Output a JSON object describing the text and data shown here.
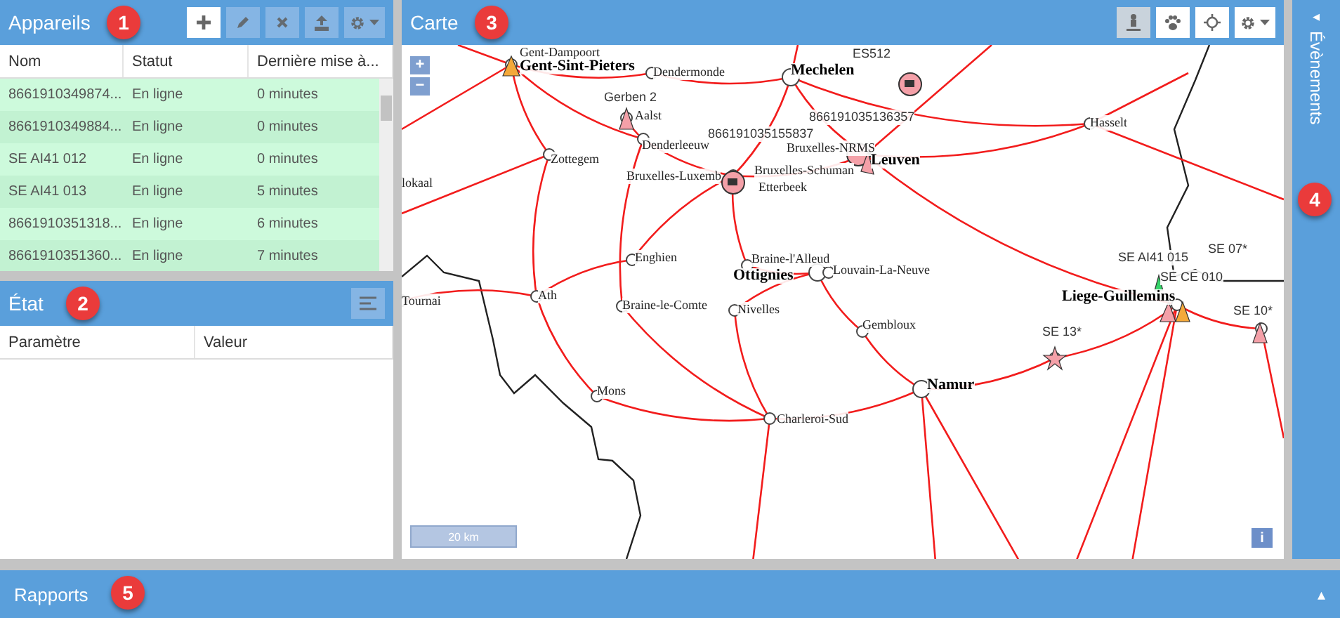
{
  "devices_panel": {
    "title": "Appareils",
    "toolbar": [
      {
        "kind": "add",
        "disabled": false
      },
      {
        "kind": "edit",
        "disabled": true
      },
      {
        "kind": "delete",
        "disabled": true
      },
      {
        "kind": "upload",
        "disabled": true
      },
      {
        "kind": "settings",
        "disabled": true
      }
    ],
    "columns": [
      "Nom",
      "Statut",
      "Dernière mise à..."
    ],
    "rows": [
      {
        "name": "8661910349874...",
        "status": "En ligne",
        "updated": "0 minutes"
      },
      {
        "name": "8661910349884...",
        "status": "En ligne",
        "updated": "0 minutes"
      },
      {
        "name": "SE AI41 012",
        "status": "En ligne",
        "updated": "0 minutes"
      },
      {
        "name": "SE AI41 013",
        "status": "En ligne",
        "updated": "5 minutes"
      },
      {
        "name": "8661910351318...",
        "status": "En ligne",
        "updated": "6 minutes"
      },
      {
        "name": "8661910351360...",
        "status": "En ligne",
        "updated": "7 minutes"
      }
    ]
  },
  "state_panel": {
    "title": "État",
    "columns": [
      "Paramètre",
      "Valeur"
    ]
  },
  "map_panel": {
    "title": "Carte",
    "toolbar": [
      {
        "kind": "person",
        "selected": true
      },
      {
        "kind": "paw",
        "selected": false
      },
      {
        "kind": "locate",
        "selected": false
      },
      {
        "kind": "settings",
        "selected": false
      }
    ],
    "zoom_in": "+",
    "zoom_out": "−",
    "labels": [
      {
        "text": "Gent-Dampoort",
        "kind": "station"
      },
      {
        "text": "Gent-Sint-Pieters",
        "kind": "major"
      },
      {
        "text": "Dendermonde",
        "kind": "station"
      },
      {
        "text": "Mechelen",
        "kind": "major"
      },
      {
        "text": "ES512",
        "kind": "device"
      },
      {
        "text": "Gerben 2",
        "kind": "device"
      },
      {
        "text": "Aalst",
        "kind": "station"
      },
      {
        "text": "866191035155837",
        "kind": "device"
      },
      {
        "text": "866191035136357",
        "kind": "device"
      },
      {
        "text": "Bruxelles-NRMS",
        "kind": "station"
      },
      {
        "text": "Leuven",
        "kind": "major"
      },
      {
        "text": "Denderleeuw",
        "kind": "station"
      },
      {
        "text": "Zottegem",
        "kind": "station"
      },
      {
        "text": "lokaal",
        "kind": "station"
      },
      {
        "text": "Bruxelles-Luxemb",
        "kind": "station"
      },
      {
        "text": "Bruxelles-Schuman",
        "kind": "station"
      },
      {
        "text": "Etterbeek",
        "kind": "station"
      },
      {
        "text": "Hasselt",
        "kind": "station"
      },
      {
        "text": "Enghien",
        "kind": "station"
      },
      {
        "text": "Braine-l'Alleud",
        "kind": "station"
      },
      {
        "text": "Ottignies",
        "kind": "major"
      },
      {
        "text": "Louvain-La-Neuve",
        "kind": "station"
      },
      {
        "text": "Tournai",
        "kind": "station"
      },
      {
        "text": "Ath",
        "kind": "station"
      },
      {
        "text": "Braine-le-Comte",
        "kind": "station"
      },
      {
        "text": "Nivelles",
        "kind": "station"
      },
      {
        "text": "Gembloux",
        "kind": "station"
      },
      {
        "text": "Mons",
        "kind": "station"
      },
      {
        "text": "Charleroi-Sud",
        "kind": "station"
      },
      {
        "text": "Namur",
        "kind": "major"
      },
      {
        "text": "SE 13*",
        "kind": "device"
      },
      {
        "text": "SE AI41 015",
        "kind": "device"
      },
      {
        "text": "SE 07*",
        "kind": "device"
      },
      {
        "text": "SE CE 010",
        "kind": "device"
      },
      {
        "text": "Liege-Guillemins",
        "kind": "major"
      },
      {
        "text": "SE 10*",
        "kind": "device"
      }
    ],
    "scale": "20 km",
    "info": "i"
  },
  "events_panel": {
    "title": "Évènements",
    "collapse": "◂"
  },
  "reports_panel": {
    "title": "Rapports",
    "expand": "▴"
  },
  "callouts": [
    "1",
    "2",
    "3",
    "4",
    "5"
  ]
}
